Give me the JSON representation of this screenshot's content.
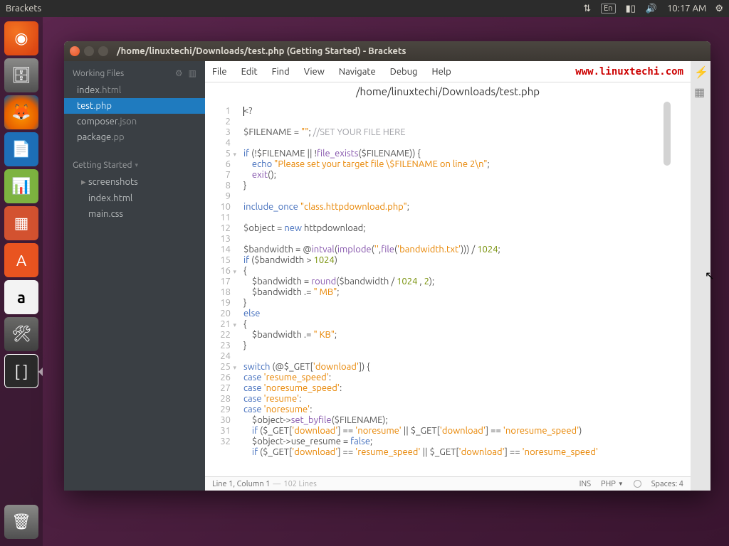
{
  "panel": {
    "app": "Brackets",
    "lang": "En",
    "time": "10:17 AM"
  },
  "launcher": {
    "items": [
      {
        "name": "ubuntu-dash",
        "glyph": "◉",
        "cls": "ubuntu"
      },
      {
        "name": "files",
        "glyph": "🗄",
        "cls": "files"
      },
      {
        "name": "firefox",
        "glyph": "🦊",
        "cls": "firefox"
      },
      {
        "name": "writer",
        "glyph": "📄",
        "cls": "writer"
      },
      {
        "name": "calc",
        "glyph": "📊",
        "cls": "calc"
      },
      {
        "name": "impress",
        "glyph": "▦",
        "cls": "impress"
      },
      {
        "name": "software",
        "glyph": "A",
        "cls": "soft"
      },
      {
        "name": "amazon",
        "glyph": "a",
        "cls": "amazon"
      },
      {
        "name": "settings",
        "glyph": "🛠",
        "cls": "settings"
      },
      {
        "name": "brackets",
        "glyph": "[ ]",
        "cls": "brackets"
      }
    ]
  },
  "window": {
    "title": "/home/linuxtechi/Downloads/test.php (Getting Started) - Brackets",
    "path": "/home/linuxtechi/Downloads/test.php"
  },
  "sidebar": {
    "working_header": "Working Files",
    "working": [
      {
        "base": "index",
        "ext": ".html",
        "active": false
      },
      {
        "base": "test",
        "ext": ".php",
        "active": true
      },
      {
        "base": "composer",
        "ext": ".json",
        "active": false
      },
      {
        "base": "package",
        "ext": ".pp",
        "active": false
      }
    ],
    "project_header": "Getting Started",
    "folders": [
      {
        "name": "screenshots"
      }
    ],
    "files": [
      {
        "base": "index",
        "ext": ".html"
      },
      {
        "base": "main",
        "ext": ".css"
      }
    ]
  },
  "menu": [
    "File",
    "Edit",
    "Find",
    "View",
    "Navigate",
    "Debug",
    "Help"
  ],
  "brand": "www.linuxtechi.com",
  "status": {
    "pos": "Line 1, Column 1",
    "total": "102 Lines",
    "ins": "INS",
    "lang": "PHP",
    "spaces": "Spaces:  4"
  },
  "code": [
    {
      "n": 1,
      "fold": "",
      "html": "<span class='cursor'></span>&lt;?"
    },
    {
      "n": 2,
      "fold": "",
      "html": ""
    },
    {
      "n": 3,
      "fold": "",
      "html": "$FILENAME = <span class='str'>\"\"</span>; <span class='cm'>//SET YOUR FILE HERE</span>"
    },
    {
      "n": 4,
      "fold": "",
      "html": ""
    },
    {
      "n": 5,
      "fold": "▾",
      "html": "<span class='kw'>if</span> (!$FILENAME || !<span class='fn'>file_exists</span>($FILENAME)) {"
    },
    {
      "n": 6,
      "fold": "",
      "html": "    <span class='kw'>echo</span> <span class='str'>\"Please set your target file \\$FILENAME on line 2\\n\"</span>;"
    },
    {
      "n": 7,
      "fold": "",
      "html": "    <span class='fn'>exit</span>();"
    },
    {
      "n": 8,
      "fold": "",
      "html": "}"
    },
    {
      "n": 9,
      "fold": "",
      "html": ""
    },
    {
      "n": 10,
      "fold": "",
      "html": "<span class='kw'>include_once</span> <span class='str'>\"class.httpdownload.php\"</span>;"
    },
    {
      "n": 11,
      "fold": "",
      "html": ""
    },
    {
      "n": 12,
      "fold": "",
      "html": "$object = <span class='kw'>new</span> httpdownload;"
    },
    {
      "n": 13,
      "fold": "",
      "html": ""
    },
    {
      "n": 14,
      "fold": "",
      "html": "$bandwidth = @<span class='fn'>intval</span>(<span class='fn'>implode</span>(<span class='str'>''</span>,<span class='fn'>file</span>(<span class='str'>'bandwidth.txt'</span>))) / <span class='num'>1024</span>;"
    },
    {
      "n": 15,
      "fold": "",
      "html": "<span class='kw'>if</span> ($bandwidth &gt; <span class='num'>1024</span>)"
    },
    {
      "n": 16,
      "fold": "▾",
      "html": "{"
    },
    {
      "n": 17,
      "fold": "",
      "html": "    $bandwidth = <span class='fn'>round</span>($bandwidth / <span class='num'>1024</span> , <span class='num'>2</span>);"
    },
    {
      "n": 18,
      "fold": "",
      "html": "    $bandwidth .= <span class='str'>\" MB\"</span>;"
    },
    {
      "n": 19,
      "fold": "",
      "html": "}"
    },
    {
      "n": 20,
      "fold": "",
      "html": "<span class='kw'>else</span>"
    },
    {
      "n": 21,
      "fold": "▾",
      "html": "{"
    },
    {
      "n": 22,
      "fold": "",
      "html": "    $bandwidth .= <span class='str'>\" KB\"</span>;"
    },
    {
      "n": 23,
      "fold": "",
      "html": "}"
    },
    {
      "n": 24,
      "fold": "",
      "html": ""
    },
    {
      "n": 25,
      "fold": "▾",
      "html": "<span class='kw'>switch</span> (@$_GET[<span class='str'>'download'</span>]) {"
    },
    {
      "n": 26,
      "fold": "",
      "html": "<span class='kw'>case</span> <span class='str'>'resume_speed'</span>:"
    },
    {
      "n": 27,
      "fold": "",
      "html": "<span class='kw'>case</span> <span class='str'>'noresume_speed'</span>:"
    },
    {
      "n": 28,
      "fold": "",
      "html": "<span class='kw'>case</span> <span class='str'>'resume'</span>:"
    },
    {
      "n": 29,
      "fold": "",
      "html": "<span class='kw'>case</span> <span class='str'>'noresume'</span>:"
    },
    {
      "n": 30,
      "fold": "",
      "html": "    $object-&gt;<span class='fn'>set_byfile</span>($FILENAME);"
    },
    {
      "n": 31,
      "fold": "",
      "html": "    <span class='kw'>if</span> ($_GET[<span class='str'>'download'</span>] == <span class='str'>'noresume'</span> || $_GET[<span class='str'>'download'</span>] == <span class='str'>'noresume_speed'</span>)"
    },
    {
      "n": 32,
      "fold": "",
      "html": "    $object-&gt;use_resume = <span class='kw'>false</span>;<br>    <span class='kw'>if</span> ($_GET[<span class='str'>'download'</span>] == <span class='str'>'resume_speed'</span> || $_GET[<span class='str'>'download'</span>] == <span class='str'>'noresume_speed'</span>"
    }
  ]
}
